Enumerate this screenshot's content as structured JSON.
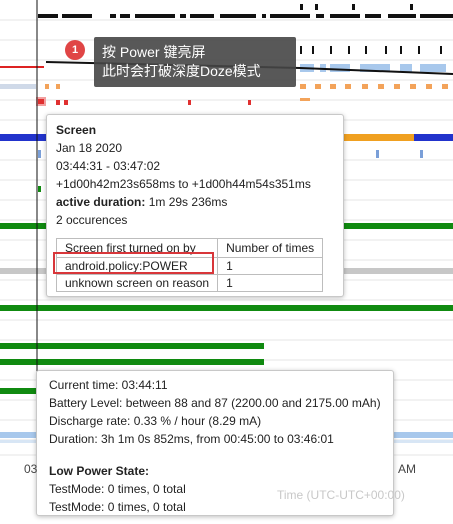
{
  "callout": {
    "step": "1",
    "line1": "按 Power 键亮屏",
    "line2": "此时会打破深度Doze模式"
  },
  "screen_tip": {
    "title": "Screen",
    "date": "Jan 18 2020",
    "time_range": "03:44:31 - 03:47:02",
    "offset_range": "+1d00h42m23s658ms to +1d00h44m54s351ms",
    "active_label": "active duration:",
    "active_value": "1m 29s 236ms",
    "occurrences": "2 occurences",
    "table": {
      "headers": [
        "Screen first turned on by",
        "Number of times"
      ],
      "rows": [
        [
          "android.policy:POWER",
          "1"
        ],
        [
          "unknown screen on reason",
          "1"
        ]
      ]
    }
  },
  "battery_tip": {
    "current_time": "Current time: 03:44:11",
    "battery_level": "Battery Level: between 88 and 87 (2200.00 and 2175.00 mAh)",
    "discharge_rate": "Discharge rate: 0.33 % / hour (8.29 mA)",
    "duration": "Duration: 3h 1m 0s 852ms, from 00:45:00 to 03:46:01",
    "low_power_title": "Low Power State:",
    "testmode_1": "TestMode: 0 times, 0 total",
    "testmode_2": "TestMode: 0 times, 0 total"
  },
  "axis": {
    "tick_left": "03",
    "tick_am": "AM",
    "title": "Time (UTC-UTC+00:00)"
  },
  "colors": {
    "highlight_red": "#d8363a",
    "badge_red": "#e04545",
    "callout_bg": "#464646",
    "bar_green": "#108a10",
    "bar_blue": "#2233cc",
    "bar_orange": "#f0a020",
    "bar_black": "#111111"
  }
}
